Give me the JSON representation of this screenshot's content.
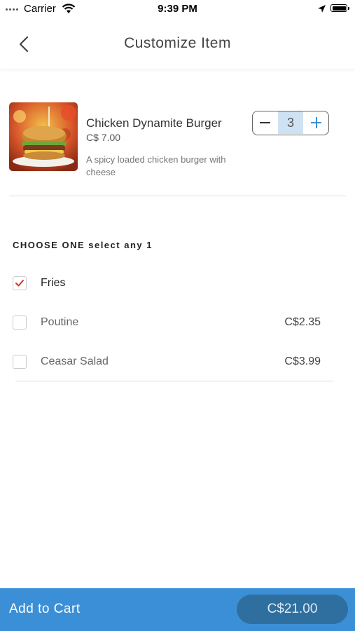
{
  "status": {
    "carrier": "Carrier",
    "time": "9:39 PM"
  },
  "nav": {
    "title": "Customize Item"
  },
  "item": {
    "name": "Chicken Dynamite Burger",
    "price": "C$ 7.00",
    "description": "A spicy loaded chicken burger with cheese",
    "quantity": "3"
  },
  "options": {
    "section_title": "CHOOSE ONE select any 1",
    "items": [
      {
        "label": "Fries",
        "price": "",
        "checked": true
      },
      {
        "label": "Poutine",
        "price": "C$2.35",
        "checked": false
      },
      {
        "label": "Ceasar Salad",
        "price": "C$3.99",
        "checked": false
      }
    ]
  },
  "footer": {
    "add_label": "Add to Cart",
    "total": "C$21.00"
  },
  "colors": {
    "accent": "#3b8fd6",
    "pill": "#2f6f9f",
    "check": "#d0342c"
  }
}
